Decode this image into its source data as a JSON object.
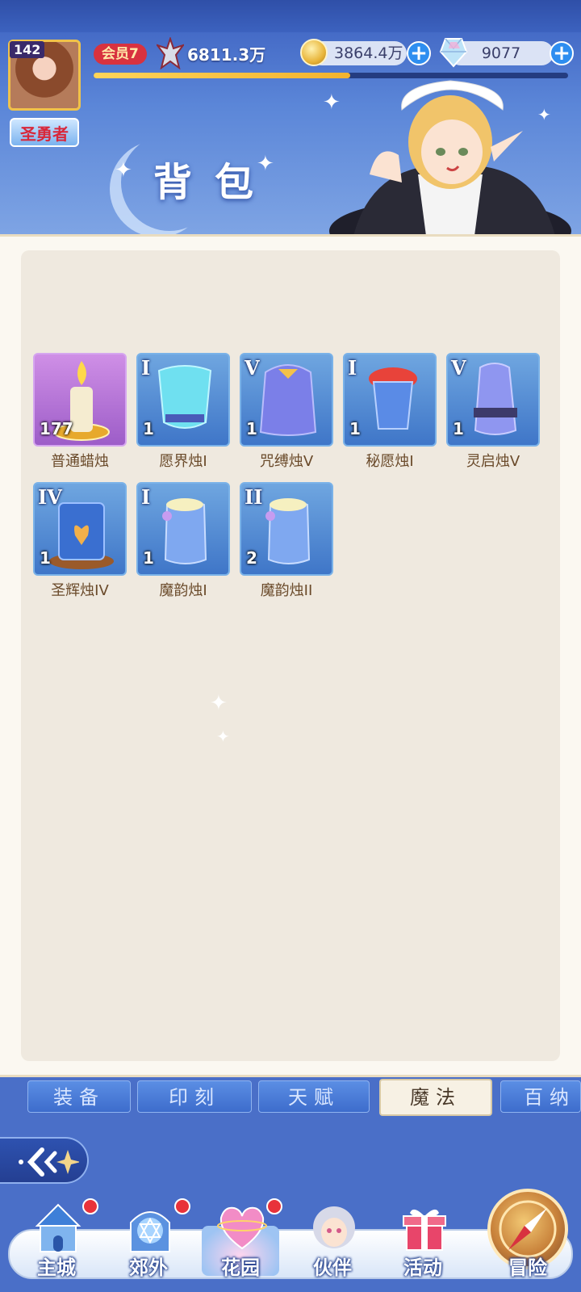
{
  "player": {
    "level": "142",
    "title": "圣勇者",
    "vip": "会员7",
    "power": "6811.3万",
    "exp_progress": 0.54
  },
  "resources": {
    "gold": "3864.4万",
    "gems": "9077"
  },
  "page_title": "背包",
  "items": [
    {
      "name": "普通蜡烛",
      "count": "177",
      "tier": "",
      "frame": "purple",
      "icon": "candle-icon"
    },
    {
      "name": "愿界烛I",
      "count": "1",
      "tier": "I",
      "frame": "blue",
      "icon": "wish-candle-icon"
    },
    {
      "name": "咒缚烛V",
      "count": "1",
      "tier": "V",
      "frame": "blue",
      "icon": "curse-candle-icon"
    },
    {
      "name": "秘愿烛I",
      "count": "1",
      "tier": "I",
      "frame": "blue",
      "icon": "secret-candle-icon"
    },
    {
      "name": "灵启烛V",
      "count": "1",
      "tier": "V",
      "frame": "blue",
      "icon": "spirit-candle-icon"
    },
    {
      "name": "圣辉烛IV",
      "count": "1",
      "tier": "IV",
      "frame": "blue",
      "icon": "holy-candle-icon"
    },
    {
      "name": "魔韵烛I",
      "count": "1",
      "tier": "I",
      "frame": "blue",
      "icon": "magic-candle-icon"
    },
    {
      "name": "魔韵烛II",
      "count": "2",
      "tier": "II",
      "frame": "blue",
      "icon": "magic-candle-icon"
    }
  ],
  "tabs": [
    {
      "label": "装备",
      "active": false
    },
    {
      "label": "印刻",
      "active": false
    },
    {
      "label": "天赋",
      "active": false
    },
    {
      "label": "魔法",
      "active": true
    },
    {
      "label": "百纳",
      "active": false
    }
  ],
  "nav": [
    {
      "label": "主城",
      "icon": "castle-icon",
      "badge": true
    },
    {
      "label": "郊外",
      "icon": "portal-icon",
      "badge": true
    },
    {
      "label": "花园",
      "icon": "heart-icon",
      "badge": true,
      "active": true
    },
    {
      "label": "伙伴",
      "icon": "partner-icon",
      "badge": false
    },
    {
      "label": "活动",
      "icon": "gift-icon",
      "badge": false
    },
    {
      "label": "冒险",
      "icon": "compass-icon",
      "badge": false
    }
  ],
  "colors": {
    "accent": "#2e8ef0",
    "vip": "#d8323f",
    "panel": "#efe9df",
    "item_text": "#6a4a2a"
  }
}
